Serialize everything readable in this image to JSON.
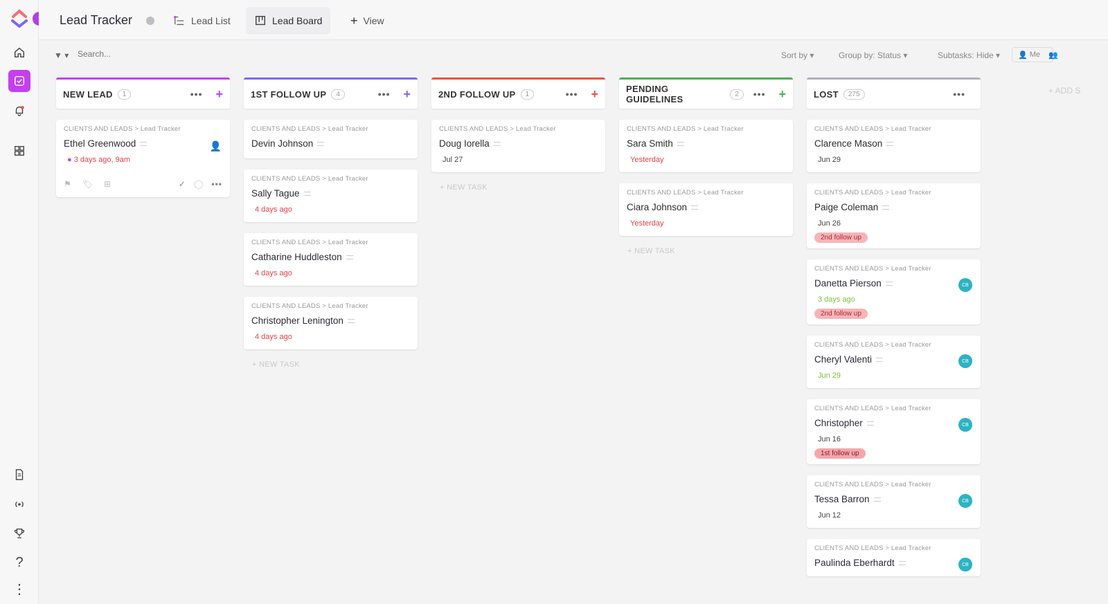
{
  "app": {
    "title": "Lead Tracker",
    "tabs": [
      {
        "label": "Lead List",
        "icon": "list-icon"
      },
      {
        "label": "Lead Board",
        "icon": "board-icon"
      },
      {
        "label": "View",
        "icon": "plus-icon"
      }
    ],
    "logo_badge": "›"
  },
  "filters": {
    "search_placeholder": "Search...",
    "sort_by": "Sort by",
    "group_by": "Group by: Status",
    "subtasks": "Subtasks: Hide",
    "me": "Me"
  },
  "add_status": "+ ADD S",
  "new_task_label": "+ NEW TASK",
  "columns": [
    {
      "title": "NEW LEAD",
      "count": "1",
      "color": "#c43ff0",
      "cards": [
        {
          "crumb": "CLIENTS AND LEADS > Lead Tracker",
          "name": "Ethel Greenwood",
          "date": "3 days ago, 9am"
        }
      ]
    },
    {
      "title": "1ST FOLLOW UP",
      "count": "4",
      "color": "#7b68ee",
      "cards": [
        {
          "crumb": "CLIENTS AND LEADS > Lead Tracker",
          "name": "Devin Johnson"
        },
        {
          "crumb": "CLIENTS AND LEADS > Lead Tracker",
          "name": "Sally Tague",
          "date": "4 days ago"
        },
        {
          "crumb": "CLIENTS AND LEADS > Lead Tracker",
          "name": "Catharine Huddleston",
          "date": "4 days ago"
        },
        {
          "crumb": "CLIENTS AND LEADS > Lead Tracker",
          "name": "Christopher Lenington",
          "date": "4 days ago"
        }
      ]
    },
    {
      "title": "2ND FOLLOW UP",
      "count": "1",
      "color": "#e8553e",
      "cards": [
        {
          "crumb": "CLIENTS AND LEADS > Lead Tracker",
          "name": "Doug Iorella",
          "date": "Jul 27"
        }
      ]
    },
    {
      "title": "PENDING GUIDELINES",
      "count": "2",
      "color": "#4caf50",
      "cards": [
        {
          "crumb": "CLIENTS AND LEADS > Lead Tracker",
          "name": "Sara Smith",
          "date": "Yesterday"
        },
        {
          "crumb": "CLIENTS AND LEADS > Lead Tracker",
          "name": "Ciara Johnson",
          "date": "Yesterday"
        }
      ]
    },
    {
      "title": "LOST",
      "count": "275",
      "color": "#b0b0b8",
      "cards": [
        {
          "crumb": "CLIENTS AND LEADS > Lead Tracker",
          "name": "Clarence Mason",
          "date": "Jun 29"
        },
        {
          "crumb": "CLIENTS AND LEADS > Lead Tracker",
          "name": "Paige Coleman",
          "date": "Jun 26",
          "tag": "2nd follow up"
        },
        {
          "crumb": "CLIENTS AND LEADS > Lead Tracker",
          "name": "Danetta Pierson",
          "date": "3 days ago",
          "tag": "2nd follow up",
          "avatar": "CB"
        },
        {
          "crumb": "CLIENTS AND LEADS > Lead Tracker",
          "name": "Cheryl Valenti",
          "date": "Jun 29",
          "avatar": "CB"
        },
        {
          "crumb": "CLIENTS AND LEADS > Lead Tracker",
          "name": "Christopher",
          "date": "Jun 16",
          "tag": "1st follow up",
          "avatar": "CB"
        },
        {
          "crumb": "CLIENTS AND LEADS > Lead Tracker",
          "name": "Tessa Barron",
          "date": "Jun 12",
          "avatar": "CB"
        },
        {
          "crumb": "CLIENTS AND LEADS > Lead Tracker",
          "name": "Paulinda Eberhardt",
          "avatar": "CB"
        }
      ]
    }
  ]
}
